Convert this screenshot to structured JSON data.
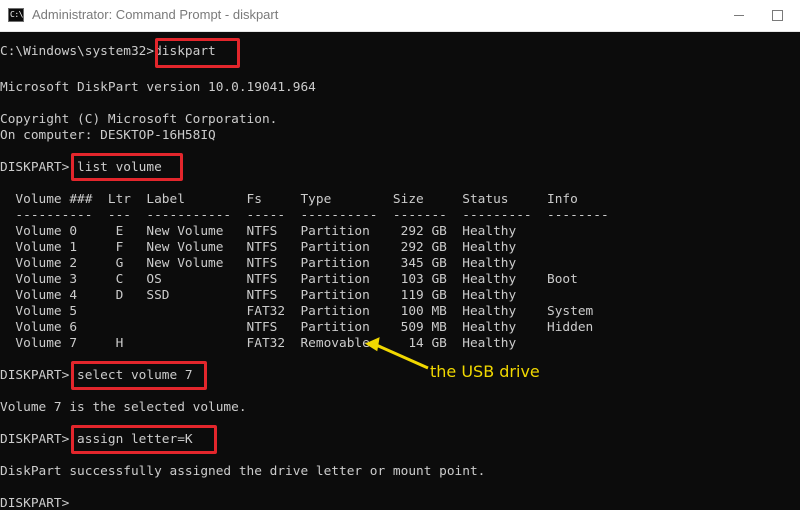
{
  "window": {
    "icon_text": "C:\\",
    "title": "Administrator: Command Prompt - diskpart",
    "icon": "cmd-icon"
  },
  "console": {
    "lines": [
      "C:\\Windows\\system32>diskpart",
      "",
      "Microsoft DiskPart version 10.0.19041.964",
      "",
      "Copyright (C) Microsoft Corporation.",
      "On computer: DESKTOP-16H58IQ",
      "",
      "DISKPART> list volume",
      "",
      "  Volume ###  Ltr  Label        Fs     Type        Size     Status     Info",
      "  ----------  ---  -----------  -----  ----------  -------  ---------  --------",
      "  Volume 0     E   New Volume   NTFS   Partition    292 GB  Healthy",
      "  Volume 1     F   New Volume   NTFS   Partition    292 GB  Healthy",
      "  Volume 2     G   New Volume   NTFS   Partition    345 GB  Healthy",
      "  Volume 3     C   OS           NTFS   Partition    103 GB  Healthy    Boot",
      "  Volume 4     D   SSD          NTFS   Partition    119 GB  Healthy",
      "  Volume 5                      FAT32  Partition    100 MB  Healthy    System",
      "  Volume 6                      NTFS   Partition    509 MB  Healthy    Hidden",
      "  Volume 7     H                FAT32  Removable     14 GB  Healthy",
      "",
      "DISKPART> select volume 7",
      "",
      "Volume 7 is the selected volume.",
      "",
      "DISKPART> assign letter=K",
      "",
      "DiskPart successfully assigned the drive letter or mount point.",
      "",
      "DISKPART> "
    ]
  },
  "annotation": {
    "callout": "the USB drive"
  },
  "colors": {
    "console_bg": "#0c0c0c",
    "console_text": "#cccccc",
    "highlight": "#e3262c",
    "callout": "#f1d800"
  }
}
